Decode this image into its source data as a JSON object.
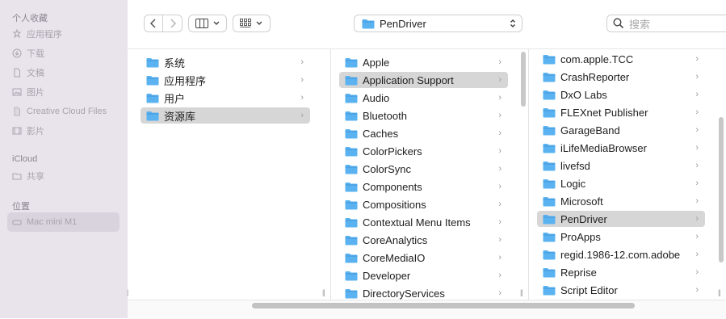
{
  "sidebar": {
    "favorites_header": "个人收藏",
    "favorites": [
      {
        "label": "应用程序",
        "icon": "applications-icon"
      },
      {
        "label": "下载",
        "icon": "downloads-icon"
      },
      {
        "label": "文稿",
        "icon": "document-icon"
      },
      {
        "label": "图片",
        "icon": "pictures-icon"
      },
      {
        "label": "Creative Cloud Files",
        "icon": "file-icon"
      },
      {
        "label": "影片",
        "icon": "movies-icon"
      }
    ],
    "icloud_header": "iCloud",
    "icloud": [
      {
        "label": "共享",
        "icon": "shared-folder-icon"
      }
    ],
    "locations_header": "位置",
    "locations": [
      {
        "label": "Mac mini M1",
        "icon": "computer-icon"
      }
    ]
  },
  "toolbar": {
    "path_folder": "PenDriver",
    "search_placeholder": "搜索"
  },
  "columns": [
    {
      "items": [
        {
          "label": "系统",
          "selected": false
        },
        {
          "label": "应用程序",
          "selected": false
        },
        {
          "label": "用户",
          "selected": false
        },
        {
          "label": "资源库",
          "selected": true
        }
      ]
    },
    {
      "items": [
        {
          "label": "Apple",
          "selected": false
        },
        {
          "label": "Application Support",
          "selected": true
        },
        {
          "label": "Audio",
          "selected": false
        },
        {
          "label": "Bluetooth",
          "selected": false
        },
        {
          "label": "Caches",
          "selected": false
        },
        {
          "label": "ColorPickers",
          "selected": false
        },
        {
          "label": "ColorSync",
          "selected": false
        },
        {
          "label": "Components",
          "selected": false
        },
        {
          "label": "Compositions",
          "selected": false
        },
        {
          "label": "Contextual Menu Items",
          "selected": false
        },
        {
          "label": "CoreAnalytics",
          "selected": false
        },
        {
          "label": "CoreMediaIO",
          "selected": false
        },
        {
          "label": "Developer",
          "selected": false
        },
        {
          "label": "DirectoryServices",
          "selected": false
        }
      ]
    },
    {
      "items": [
        {
          "label": "com.apple.TCC",
          "selected": false
        },
        {
          "label": "CrashReporter",
          "selected": false
        },
        {
          "label": "DxO Labs",
          "selected": false
        },
        {
          "label": "FLEXnet Publisher",
          "selected": false
        },
        {
          "label": "GarageBand",
          "selected": false
        },
        {
          "label": "iLifeMediaBrowser",
          "selected": false
        },
        {
          "label": "livefsd",
          "selected": false
        },
        {
          "label": "Logic",
          "selected": false
        },
        {
          "label": "Microsoft",
          "selected": false
        },
        {
          "label": "PenDriver",
          "selected": true
        },
        {
          "label": "ProApps",
          "selected": false
        },
        {
          "label": "regid.1986-12.com.adobe",
          "selected": false
        },
        {
          "label": "Reprise",
          "selected": false
        },
        {
          "label": "Script Editor",
          "selected": false
        }
      ]
    }
  ],
  "colors": {
    "folder_blue": "#5ab3f0",
    "folder_dark": "#3a8fd6",
    "sidebar_bg": "#e9e4ec",
    "selection": "#d6d6d6"
  }
}
